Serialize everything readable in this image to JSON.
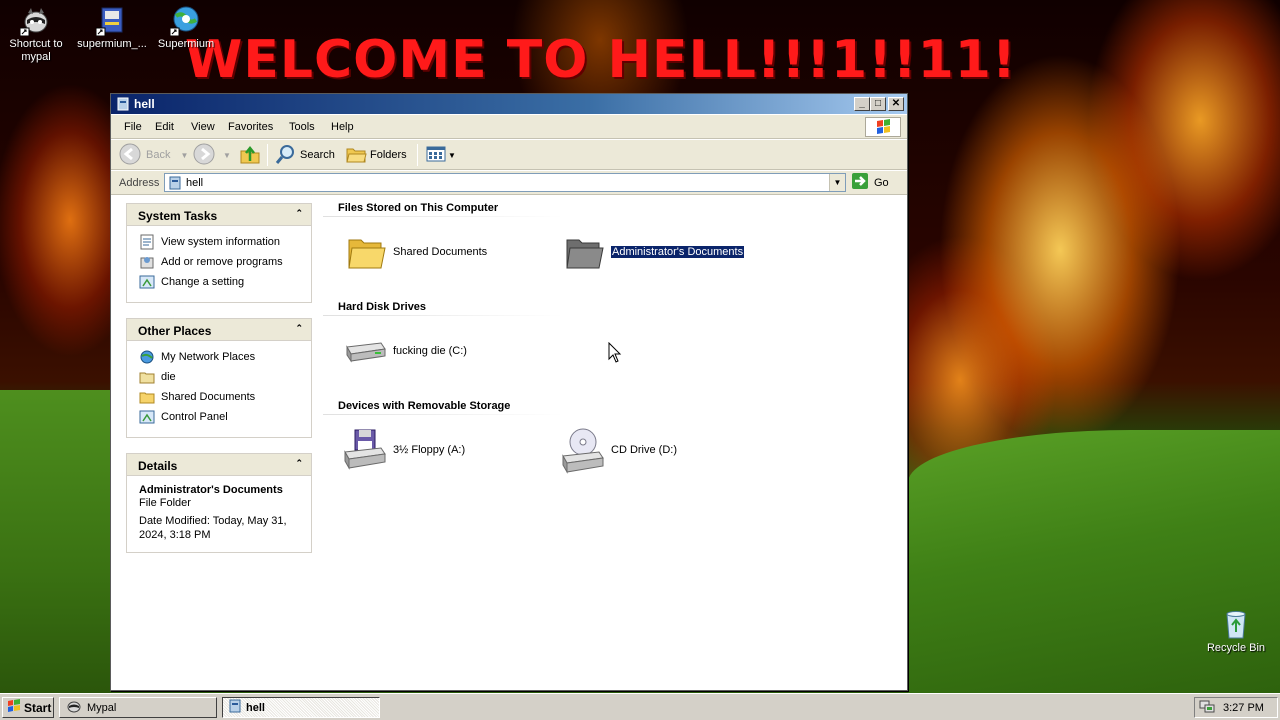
{
  "desktop": {
    "banner": "WELCOME TO HELL!!!1!!11!",
    "icons": [
      {
        "label_line1": "Shortcut to",
        "label_line2": "mypal",
        "icon": "raccoon-icon"
      },
      {
        "label_line1": "supermium_...",
        "label_line2": "",
        "icon": "installer-icon"
      },
      {
        "label_line1": "Supermium",
        "label_line2": "",
        "icon": "browser-globe-icon"
      },
      {
        "label_line1": "Recycle Bin",
        "label_line2": "",
        "icon": "recycle-bin-icon"
      }
    ]
  },
  "window": {
    "title": "hell",
    "menu": [
      "File",
      "Edit",
      "View",
      "Favorites",
      "Tools",
      "Help"
    ],
    "toolbar": {
      "back": "Back",
      "search": "Search",
      "folders": "Folders"
    },
    "address": {
      "label": "Address",
      "value": "hell",
      "go": "Go"
    }
  },
  "taskpane": {
    "system_tasks": {
      "title": "System Tasks",
      "items": [
        "View system information",
        "Add or remove programs",
        "Change a setting"
      ]
    },
    "other_places": {
      "title": "Other Places",
      "items": [
        "My Network Places",
        "die",
        "Shared Documents",
        "Control Panel"
      ]
    },
    "details": {
      "title": "Details",
      "name": "Administrator's Documents",
      "type": "File Folder",
      "modified_line1": "Date Modified: Today, May 31,",
      "modified_line2": "2024, 3:18 PM"
    }
  },
  "content": {
    "groups": [
      {
        "title": "Files Stored on This Computer",
        "items": [
          "Shared Documents",
          "Administrator's Documents"
        ]
      },
      {
        "title": "Hard Disk Drives",
        "items": [
          "fucking die (C:)"
        ]
      },
      {
        "title": "Devices with Removable Storage",
        "items": [
          "3½ Floppy (A:)",
          "CD Drive (D:)"
        ]
      }
    ],
    "selected_item": "Administrator's Documents"
  },
  "taskbar": {
    "start": "Start",
    "tasks": [
      {
        "label": "Mypal",
        "active": false
      },
      {
        "label": "hell",
        "active": true
      }
    ],
    "clock": "3:27 PM"
  },
  "colors": {
    "banner": "#ff1a1a",
    "title_bar": "#0a246a",
    "selection": "#0a246a",
    "chrome": "#ece9d8"
  }
}
